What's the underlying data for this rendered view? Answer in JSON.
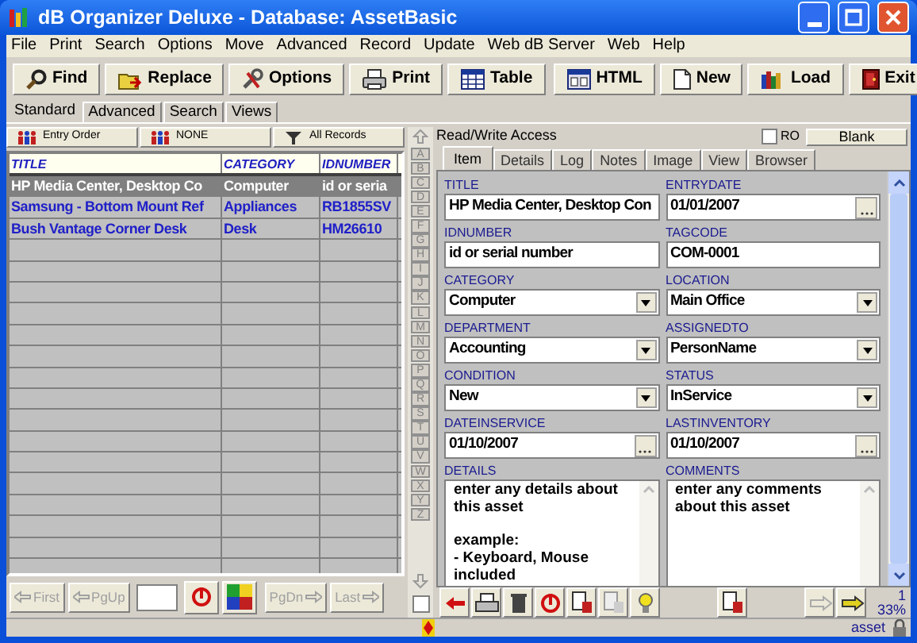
{
  "window": {
    "title": "dB Organizer Deluxe - Database: AssetBasic"
  },
  "menu": [
    "File",
    "Print",
    "Search",
    "Options",
    "Move",
    "Advanced",
    "Record",
    "Update",
    "Web dB Server",
    "Web",
    "Help"
  ],
  "toolbar": [
    "Find",
    "Replace",
    "Options",
    "Print",
    "Table",
    "HTML",
    "New",
    "Load",
    "Exit"
  ],
  "view_tabs": [
    {
      "label": "Standard",
      "selected": true
    },
    {
      "label": "Advanced",
      "selected": false
    },
    {
      "label": "Search",
      "selected": false
    },
    {
      "label": "Views",
      "selected": false
    }
  ],
  "sort_bar": [
    "Entry Order",
    "NONE",
    "All Records"
  ],
  "table": {
    "columns": [
      "TITLE",
      "CATEGORY",
      "IDNUMBER"
    ],
    "rows": [
      {
        "cells": [
          "HP Media Center, Desktop Co",
          "Computer",
          "id or seria"
        ],
        "selected": true
      },
      {
        "cells": [
          "Samsung - Bottom Mount Ref",
          "Appliances",
          "RB1855SV"
        ],
        "selected": false
      },
      {
        "cells": [
          "Bush Vantage Corner Desk",
          "Desk",
          "HM26610"
        ],
        "selected": false
      }
    ]
  },
  "navigation": [
    {
      "label": "First",
      "disabled": true
    },
    {
      "label": "PgUp",
      "disabled": true
    },
    {
      "label": "PgDn",
      "disabled": true
    },
    {
      "label": "Last",
      "disabled": true
    }
  ],
  "strip_checkbox": {
    "checked": false
  },
  "letters": [
    "A",
    "B",
    "C",
    "D",
    "E",
    "F",
    "G",
    "H",
    "I",
    "J",
    "K",
    "L",
    "M",
    "N",
    "O",
    "P",
    "Q",
    "R",
    "S",
    "T",
    "U",
    "V",
    "W",
    "X",
    "Y",
    "Z"
  ],
  "access": "Read/Write Access",
  "ro": {
    "label": "RO",
    "checked": false
  },
  "blank_button": "Blank",
  "record_tabs": [
    {
      "label": "Item",
      "selected": true
    },
    {
      "label": "Details",
      "selected": false
    },
    {
      "label": "Log",
      "selected": false
    },
    {
      "label": "Notes",
      "selected": false
    },
    {
      "label": "Image",
      "selected": false
    },
    {
      "label": "View",
      "selected": false
    },
    {
      "label": "Browser",
      "selected": false
    }
  ],
  "fields": [
    {
      "label": "TITLE",
      "value": "HP Media Center, Desktop Con",
      "kind": "text"
    },
    {
      "label": "ENTRYDATE",
      "value": "01/01/2007",
      "kind": "date"
    },
    {
      "label": "IDNUMBER",
      "value": "id or serial number",
      "kind": "text"
    },
    {
      "label": "TAGCODE",
      "value": "COM-0001",
      "kind": "text"
    },
    {
      "label": "CATEGORY",
      "value": "Computer",
      "kind": "dropdown"
    },
    {
      "label": "LOCATION",
      "value": "Main Office",
      "kind": "dropdown"
    },
    {
      "label": "DEPARTMENT",
      "value": "Accounting",
      "kind": "dropdown"
    },
    {
      "label": "ASSIGNEDTO",
      "value": "PersonName",
      "kind": "dropdown"
    },
    {
      "label": "CONDITION",
      "value": "New",
      "kind": "dropdown"
    },
    {
      "label": "STATUS",
      "value": "InService",
      "kind": "dropdown"
    },
    {
      "label": "DATEINSERVICE",
      "value": "01/10/2007",
      "kind": "date"
    },
    {
      "label": "LASTINVENTORY",
      "value": "01/10/2007",
      "kind": "date"
    },
    {
      "label": "DETAILS",
      "value": "enter any details about this asset\n\nexample:\n- Keyboard, Mouse\nincluded",
      "kind": "memo"
    },
    {
      "label": "COMMENTS",
      "value": "enter any comments about this asset",
      "kind": "memo"
    }
  ],
  "record_number": "1",
  "percent": "33%",
  "status_bar": {
    "table": "asset"
  }
}
